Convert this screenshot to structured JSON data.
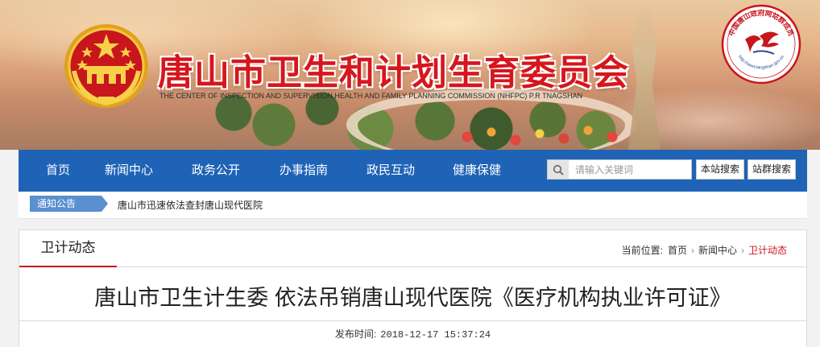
{
  "header": {
    "title": "唐山市卫生和计划生育委员会",
    "subtitle": "THE CENTER OF INSPECTION AND SUPERVISION,HEALTH AND FAMILY PLANNING COMMISSION (NHFPC) P.R TNAGSHAN",
    "group_logo": {
      "ring_text": "中国唐山政府网站群成员",
      "url_text": "http://www.tangshan.gov.cn"
    }
  },
  "nav": {
    "items": [
      {
        "label": "首页"
      },
      {
        "label": "新闻中心"
      },
      {
        "label": "政务公开"
      },
      {
        "label": "办事指南"
      },
      {
        "label": "政民互动"
      },
      {
        "label": "健康保健"
      }
    ],
    "search": {
      "placeholder": "请输入关键词",
      "site_search_label": "本站搜索",
      "group_search_label": "站群搜索"
    }
  },
  "notice": {
    "label": "通知公告",
    "text": "唐山市迅速依法查封唐山现代医院"
  },
  "main": {
    "section_tab": "卫计动态",
    "breadcrumb": {
      "prefix": "当前位置:",
      "items": [
        "首页",
        "新闻中心",
        "卫计动态"
      ]
    },
    "article_title": "唐山市卫生计生委 依法吊销唐山现代医院《医疗机构执业许可证》",
    "publish_label": "发布时间:",
    "publish_time": "2018-12-17 15:37:24"
  },
  "colors": {
    "nav_bg": "#1f63b6",
    "title_red": "#d6161d",
    "accent_red": "#c8161d",
    "notice_label_bg": "#5a8fd0"
  },
  "icons": {
    "emblem": "national-emblem-icon",
    "search": "search-icon",
    "breadcrumb_separator": "chevron-right-icon"
  }
}
